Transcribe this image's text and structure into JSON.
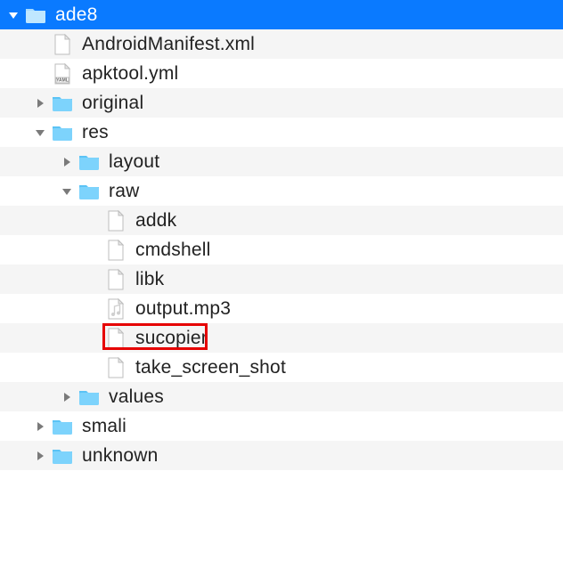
{
  "tree": {
    "indent_step": 30,
    "rows": [
      {
        "depth": 0,
        "kind": "folder",
        "label": "ade8",
        "disclosure": "open",
        "selected": true,
        "alt": false,
        "icon": "folder"
      },
      {
        "depth": 1,
        "kind": "file",
        "label": "AndroidManifest.xml",
        "disclosure": "none",
        "selected": false,
        "alt": true,
        "icon": "file"
      },
      {
        "depth": 1,
        "kind": "file",
        "label": "apktool.yml",
        "disclosure": "none",
        "selected": false,
        "alt": false,
        "icon": "yaml"
      },
      {
        "depth": 1,
        "kind": "folder",
        "label": "original",
        "disclosure": "closed",
        "selected": false,
        "alt": true,
        "icon": "folder"
      },
      {
        "depth": 1,
        "kind": "folder",
        "label": "res",
        "disclosure": "open",
        "selected": false,
        "alt": false,
        "icon": "folder"
      },
      {
        "depth": 2,
        "kind": "folder",
        "label": "layout",
        "disclosure": "closed",
        "selected": false,
        "alt": true,
        "icon": "folder"
      },
      {
        "depth": 2,
        "kind": "folder",
        "label": "raw",
        "disclosure": "open",
        "selected": false,
        "alt": false,
        "icon": "folder"
      },
      {
        "depth": 3,
        "kind": "file",
        "label": "addk",
        "disclosure": "none",
        "selected": false,
        "alt": true,
        "icon": "file"
      },
      {
        "depth": 3,
        "kind": "file",
        "label": "cmdshell",
        "disclosure": "none",
        "selected": false,
        "alt": false,
        "icon": "file"
      },
      {
        "depth": 3,
        "kind": "file",
        "label": "libk",
        "disclosure": "none",
        "selected": false,
        "alt": true,
        "icon": "file"
      },
      {
        "depth": 3,
        "kind": "file",
        "label": "output.mp3",
        "disclosure": "none",
        "selected": false,
        "alt": false,
        "icon": "audiofile"
      },
      {
        "depth": 3,
        "kind": "file",
        "label": "sucopier",
        "disclosure": "none",
        "selected": false,
        "alt": true,
        "icon": "file",
        "highlighted": true
      },
      {
        "depth": 3,
        "kind": "file",
        "label": "take_screen_shot",
        "disclosure": "none",
        "selected": false,
        "alt": false,
        "icon": "file"
      },
      {
        "depth": 2,
        "kind": "folder",
        "label": "values",
        "disclosure": "closed",
        "selected": false,
        "alt": true,
        "icon": "folder"
      },
      {
        "depth": 1,
        "kind": "folder",
        "label": "smali",
        "disclosure": "closed",
        "selected": false,
        "alt": false,
        "icon": "folder"
      },
      {
        "depth": 1,
        "kind": "folder",
        "label": "unknown",
        "disclosure": "closed",
        "selected": false,
        "alt": true,
        "icon": "folder"
      }
    ]
  },
  "colors": {
    "selection": "#0a7aff",
    "highlight_border": "#e60000"
  }
}
